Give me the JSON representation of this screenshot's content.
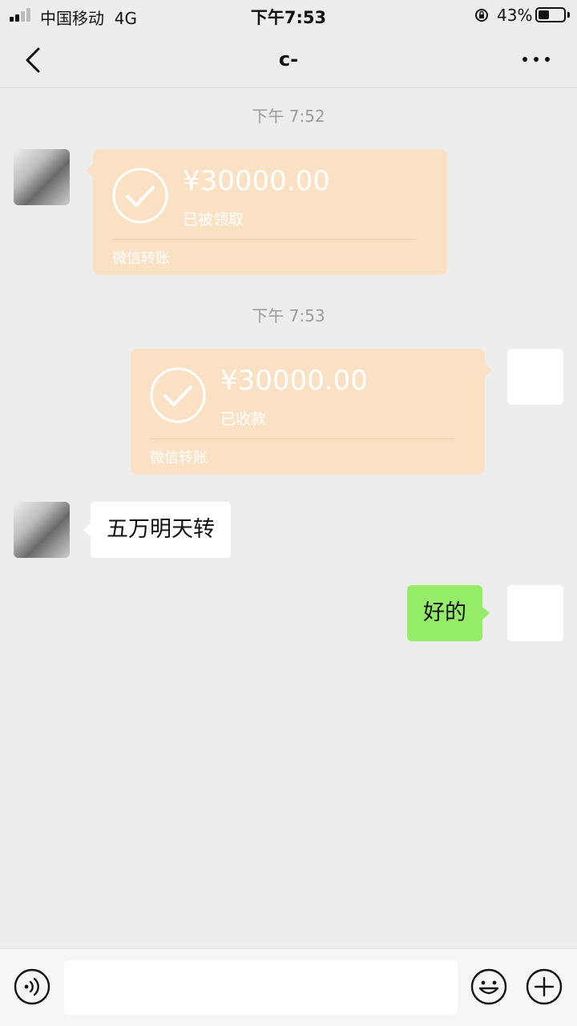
{
  "status_bar": {
    "carrier": "中国移动",
    "network": "4G",
    "time": "下午7:53",
    "battery_percent": "43%",
    "battery_level": 0.43
  },
  "nav": {
    "title": "c-"
  },
  "messages": [
    {
      "type": "timestamp",
      "text": "下午 7:52"
    },
    {
      "type": "transfer",
      "side": "left",
      "amount": "¥30000.00",
      "status": "已被领取",
      "footer": "微信转账"
    },
    {
      "type": "timestamp",
      "text": "下午 7:53"
    },
    {
      "type": "transfer",
      "side": "right",
      "amount": "¥30000.00",
      "status": "已收款",
      "footer": "微信转账"
    },
    {
      "type": "text",
      "side": "left",
      "text": "五万明天转"
    },
    {
      "type": "text",
      "side": "right",
      "text": "好的"
    }
  ],
  "input_bar": {
    "value": ""
  },
  "colors": {
    "background": "#ededed",
    "transfer_card": "#fbe1c4",
    "sent_bubble": "#95ec69",
    "received_bubble": "#ffffff"
  }
}
